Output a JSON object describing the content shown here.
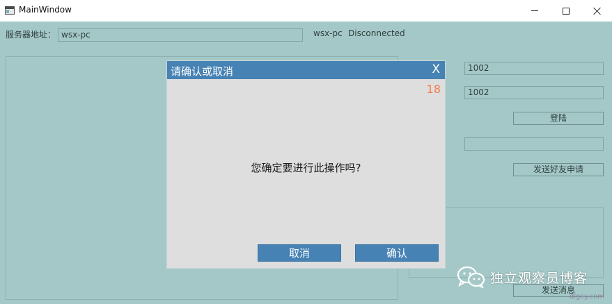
{
  "window": {
    "title": "MainWindow"
  },
  "main": {
    "server_label": "服务器地址：",
    "server_value": "wsx-pc",
    "host_name": "wsx-pc",
    "connection_status": "Disconnected",
    "account_value": "1002",
    "password_value": "1002",
    "login_label": "登陆",
    "friend_input_value": "",
    "send_friend_request_label": "发送好友申请",
    "send_message_label": "发送消息"
  },
  "dialog": {
    "title": "请确认或取消",
    "close_label": "X",
    "countdown": "18",
    "message": "您确定要进行此操作吗?",
    "cancel_label": "取消",
    "confirm_label": "确认"
  },
  "watermark": {
    "text": "独立观察员博客",
    "url": "dlgcy.com"
  },
  "icons": {
    "app": "window-app-icon",
    "minimize": "minimize-icon",
    "maximize": "maximize-icon",
    "close": "close-icon",
    "wechat": "wechat-icon"
  },
  "colors": {
    "client_background": "#a4c8c7",
    "dialog_header": "#4682b4",
    "dialog_body": "#dedede",
    "countdown": "#f47b4e",
    "dialog_button": "#4682b4"
  }
}
